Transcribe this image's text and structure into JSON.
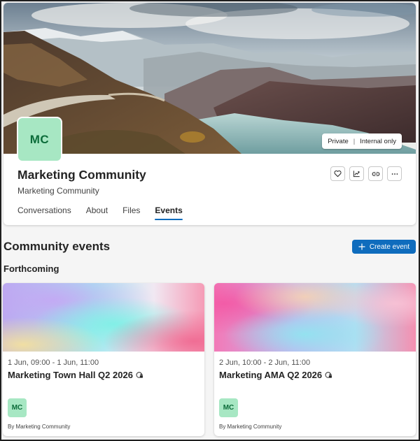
{
  "community": {
    "name": "Marketing Community",
    "subtitle": "Marketing Community",
    "initials": "MC",
    "privacy_label": "Private",
    "visibility_label": "Internal only",
    "accent_color": "#a7e7c3"
  },
  "header_actions": [
    {
      "icon": "heart-icon"
    },
    {
      "icon": "analytics-icon"
    },
    {
      "icon": "link-icon"
    },
    {
      "icon": "more-icon"
    }
  ],
  "tabs": [
    {
      "label": "Conversations",
      "active": false
    },
    {
      "label": "About",
      "active": false
    },
    {
      "label": "Files",
      "active": false
    },
    {
      "label": "Events",
      "active": true
    }
  ],
  "events_section": {
    "title": "Community events",
    "create_button_label": "Create event",
    "subsection_title": "Forthcoming",
    "brand_color": "#0f6cbd"
  },
  "events": [
    {
      "date_range": "1 Jun, 09:00 - 1 Jun, 11:00",
      "title": "Marketing Town Hall Q2 2026",
      "organizer_initials": "MC",
      "by_label": "By Marketing Community"
    },
    {
      "date_range": "2 Jun, 10:00 - 2 Jun, 11:00",
      "title": "Marketing AMA Q2 2026",
      "organizer_initials": "MC",
      "by_label": "By Marketing Community"
    }
  ]
}
